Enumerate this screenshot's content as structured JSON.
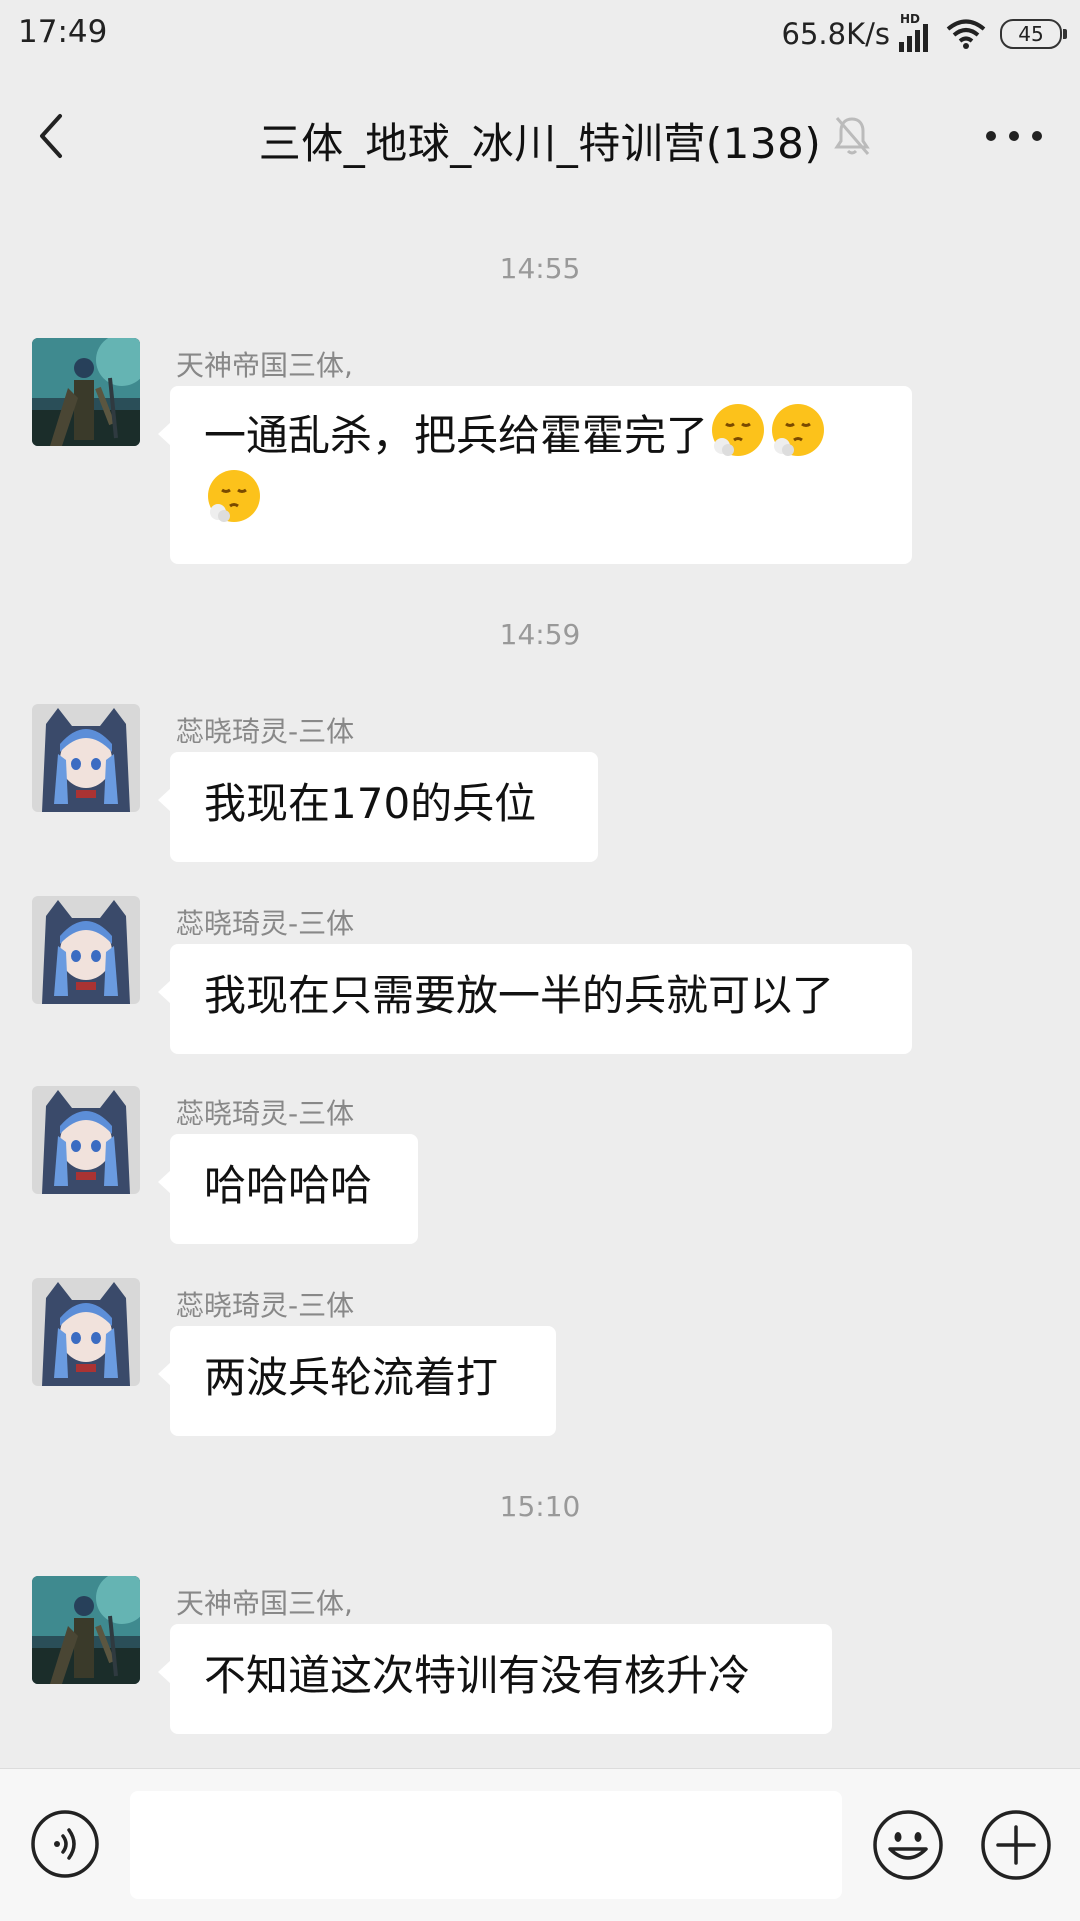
{
  "status_bar": {
    "time": "17:49",
    "network_speed": "65.8K/s",
    "network_type": "HD",
    "battery": "45"
  },
  "header": {
    "title": "三体_地球_冰川_特训营(138)"
  },
  "messages": [
    {
      "time": "14:55",
      "sender": "天神帝国三体,",
      "text_line1": "一通乱杀，把兵给霍霍完了",
      "emoji": "sighing-face-emoji",
      "emoji_count": 3
    },
    {
      "time": "14:59",
      "sender": "蕊晓琦灵-三体",
      "text": "我现在170的兵位"
    },
    {
      "sender": "蕊晓琦灵-三体",
      "text": "我现在只需要放一半的兵就可以了"
    },
    {
      "sender": "蕊晓琦灵-三体",
      "text": "哈哈哈哈"
    },
    {
      "sender": "蕊晓琦灵-三体",
      "text": "两波兵轮流着打"
    },
    {
      "time": "15:10",
      "sender": "天神帝国三体,",
      "text": "不知道这次特训有没有核升冷"
    }
  ],
  "input": {
    "value": "",
    "placeholder": ""
  },
  "icons": {
    "back": "back-arrow-icon",
    "mute": "muted-bell-icon",
    "more": "more-options-icon",
    "voice": "voice-input-icon",
    "emoji": "emoji-icon",
    "plus": "plus-icon"
  }
}
